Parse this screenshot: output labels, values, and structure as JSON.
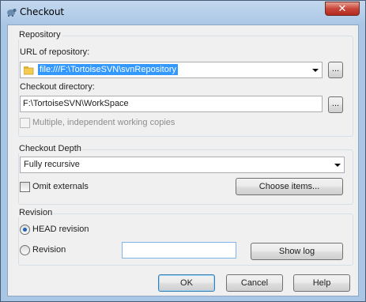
{
  "window": {
    "title": "Checkout",
    "close_label": "✕"
  },
  "repository": {
    "group_label": "Repository",
    "url_label": "URL of repository:",
    "url_value": "file:///F:\\TortoiseSVN\\svnRepository",
    "checkout_dir_label": "Checkout directory:",
    "checkout_dir_value": "F:\\TortoiseSVN\\WorkSpace",
    "browse_label": "...",
    "multiple_label": "Multiple, independent working copies"
  },
  "depth": {
    "group_label": "Checkout Depth",
    "selected": "Fully recursive",
    "omit_externals_label": "Omit externals",
    "choose_items_label": "Choose items..."
  },
  "revision": {
    "group_label": "Revision",
    "head_label": "HEAD revision",
    "revision_label": "Revision",
    "revision_value": "",
    "show_log_label": "Show log"
  },
  "footer": {
    "ok_label": "OK",
    "cancel_label": "Cancel",
    "help_label": "Help"
  }
}
